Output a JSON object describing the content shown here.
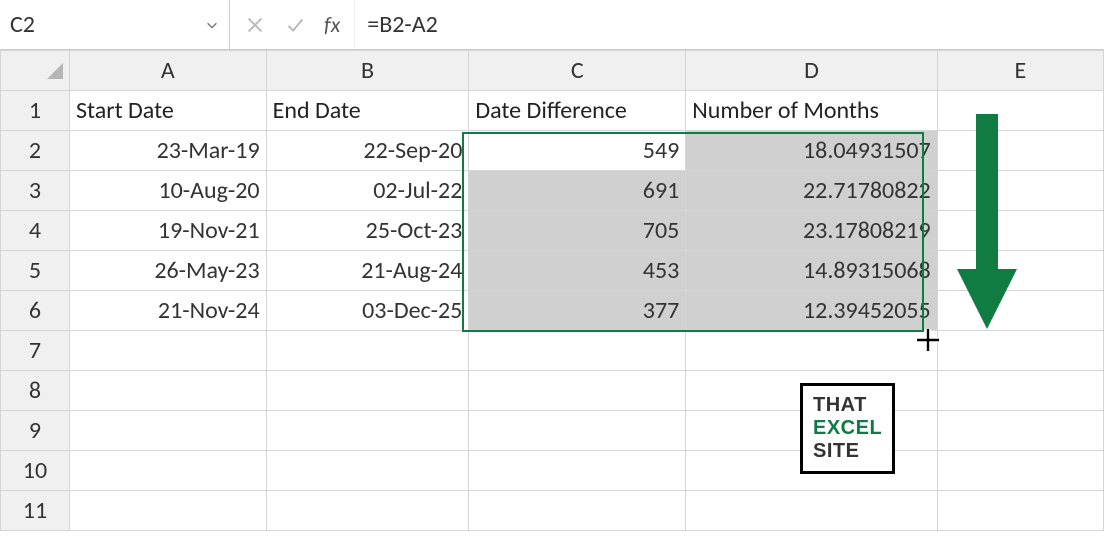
{
  "name_box": {
    "value": "C2"
  },
  "formula_bar": {
    "fx_label": "fx",
    "formula": "=B2-A2"
  },
  "columns": [
    "A",
    "B",
    "C",
    "D",
    "E"
  ],
  "headers": {
    "A": "Start Date",
    "B": "End Date",
    "C": "Date Difference",
    "D": "Number of Months"
  },
  "rows": [
    {
      "r": "1"
    },
    {
      "r": "2",
      "A": "23-Mar-19",
      "B": "22-Sep-20",
      "C": "549",
      "D": "18.04931507"
    },
    {
      "r": "3",
      "A": "10-Aug-20",
      "B": "02-Jul-22",
      "C": "691",
      "D": "22.71780822"
    },
    {
      "r": "4",
      "A": "19-Nov-21",
      "B": "25-Oct-23",
      "C": "705",
      "D": "23.17808219"
    },
    {
      "r": "5",
      "A": "26-May-23",
      "B": "21-Aug-24",
      "C": "453",
      "D": "14.89315068"
    },
    {
      "r": "6",
      "A": "21-Nov-24",
      "B": "03-Dec-25",
      "C": "377",
      "D": "12.39452055"
    },
    {
      "r": "7"
    },
    {
      "r": "8"
    },
    {
      "r": "9"
    },
    {
      "r": "10"
    },
    {
      "r": "11"
    }
  ],
  "logo": {
    "line1": "THAT",
    "line2": "EXCEL",
    "line3": "SITE"
  },
  "chart_data": {
    "type": "table",
    "title": "",
    "columns": [
      "Start Date",
      "End Date",
      "Date Difference",
      "Number of Months"
    ],
    "rows": [
      [
        "23-Mar-19",
        "22-Sep-20",
        549,
        18.04931507
      ],
      [
        "10-Aug-20",
        "02-Jul-22",
        691,
        22.71780822
      ],
      [
        "19-Nov-21",
        "25-Oct-23",
        705,
        23.17808219
      ],
      [
        "26-May-23",
        "21-Aug-24",
        453,
        14.89315068
      ],
      [
        "21-Nov-24",
        "03-Dec-25",
        377,
        12.39452055
      ]
    ]
  }
}
